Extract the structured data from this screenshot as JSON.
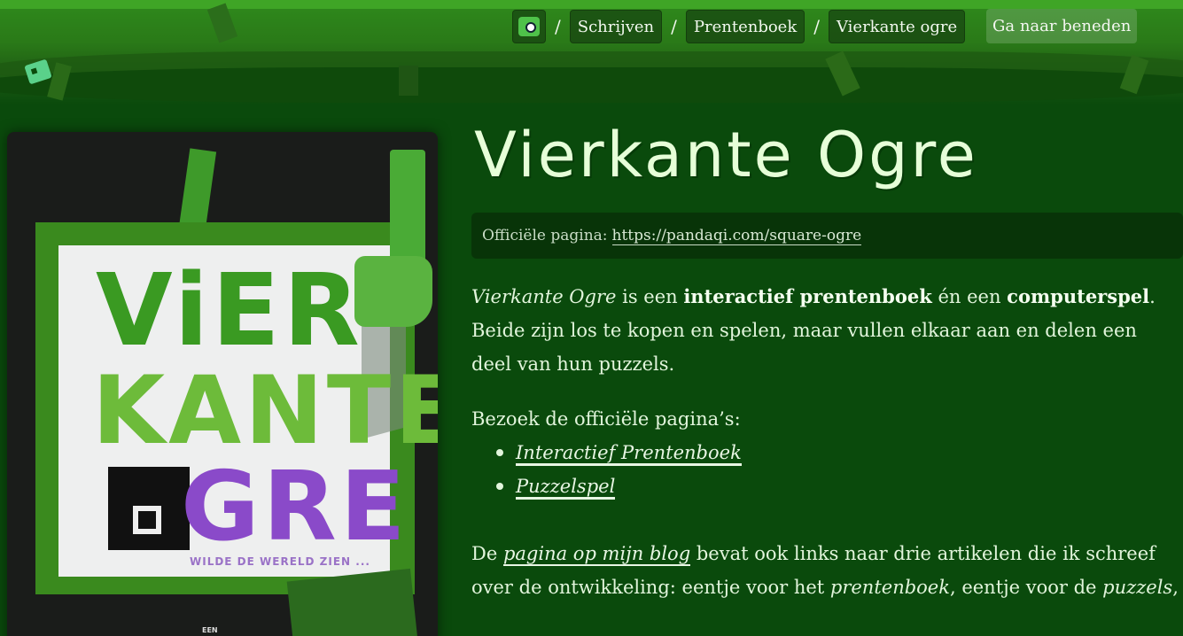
{
  "nav": {
    "home_icon": "ogre-logo-icon",
    "separator": "/",
    "crumbs": [
      "Schrijven",
      "Prentenboek",
      "Vierkante ogre"
    ],
    "goto_label": "Ga naar beneden"
  },
  "cover": {
    "line1": "ViER",
    "line2": "KANTE",
    "line3": "GRE",
    "subtitle": "WILDE DE WERELD ZIEN ...",
    "bottom": "EEN"
  },
  "main": {
    "title": "Vierkante Ogre",
    "official_label": "Officiële pagina:",
    "official_url": "https://pandaqi.com/square-ogre",
    "intro": {
      "title_em": "Vierkante Ogre",
      "t1": " is een ",
      "b1": "interactief prentenboek",
      "t2": " én een ",
      "b2": "computerspel",
      "t3": ". Beide zijn los te kopen en spelen, maar vullen elkaar aan en delen een deel van hun puzzels."
    },
    "visit_label": "Bezoek de officiële pagina’s:",
    "links": [
      "Interactief Prentenboek",
      "Puzzelspel"
    ],
    "blog": {
      "t1": "De ",
      "link": "pagina op mijn blog",
      "t2": " bevat ook links naar drie artikelen die ik schreef over de ontwikkeling: eentje voor het ",
      "em1": "prentenboek",
      "t3": ", eentje voor de ",
      "em2": "puzzels",
      "t4": ","
    }
  },
  "colors": {
    "background": "#0a4a0c",
    "text": "#e2f5dc",
    "title": "#e6ffd8"
  }
}
